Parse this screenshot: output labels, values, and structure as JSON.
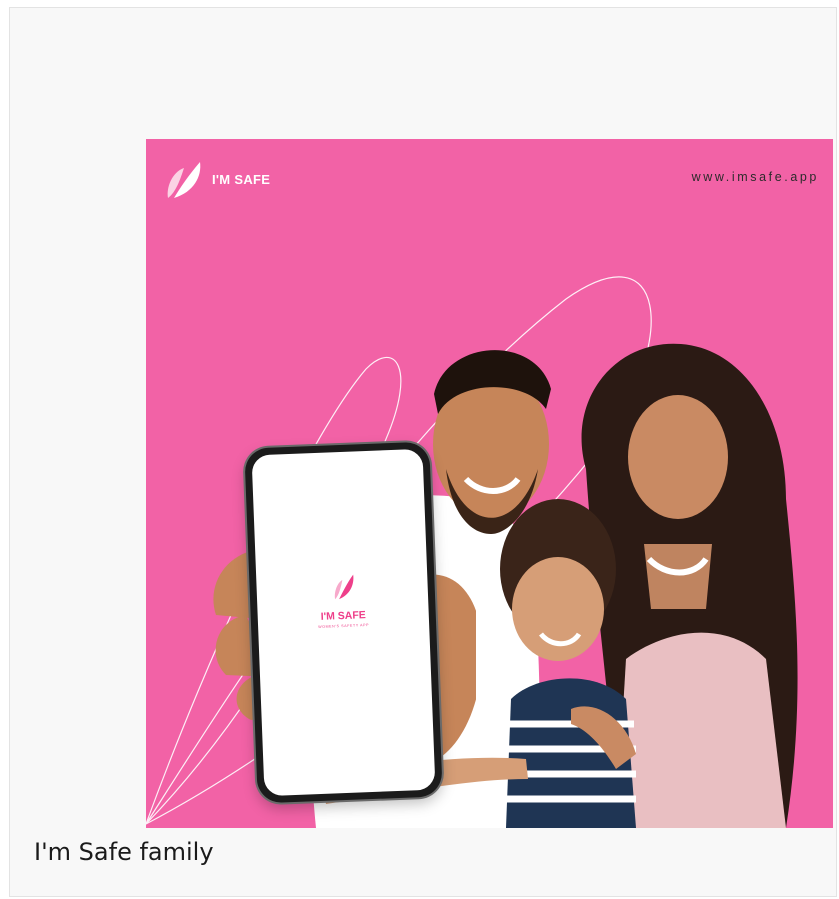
{
  "banner": {
    "brand_name": "I'M SAFE",
    "site_url": "www.imsafe.app",
    "background_color": "#f262a6",
    "phone_screen": {
      "app_name": "I'M SAFE",
      "app_tagline": "WOMEN'S SAFETY APP"
    },
    "photo_subject": "family-photo"
  },
  "caption": {
    "text": "I'm Safe family"
  }
}
